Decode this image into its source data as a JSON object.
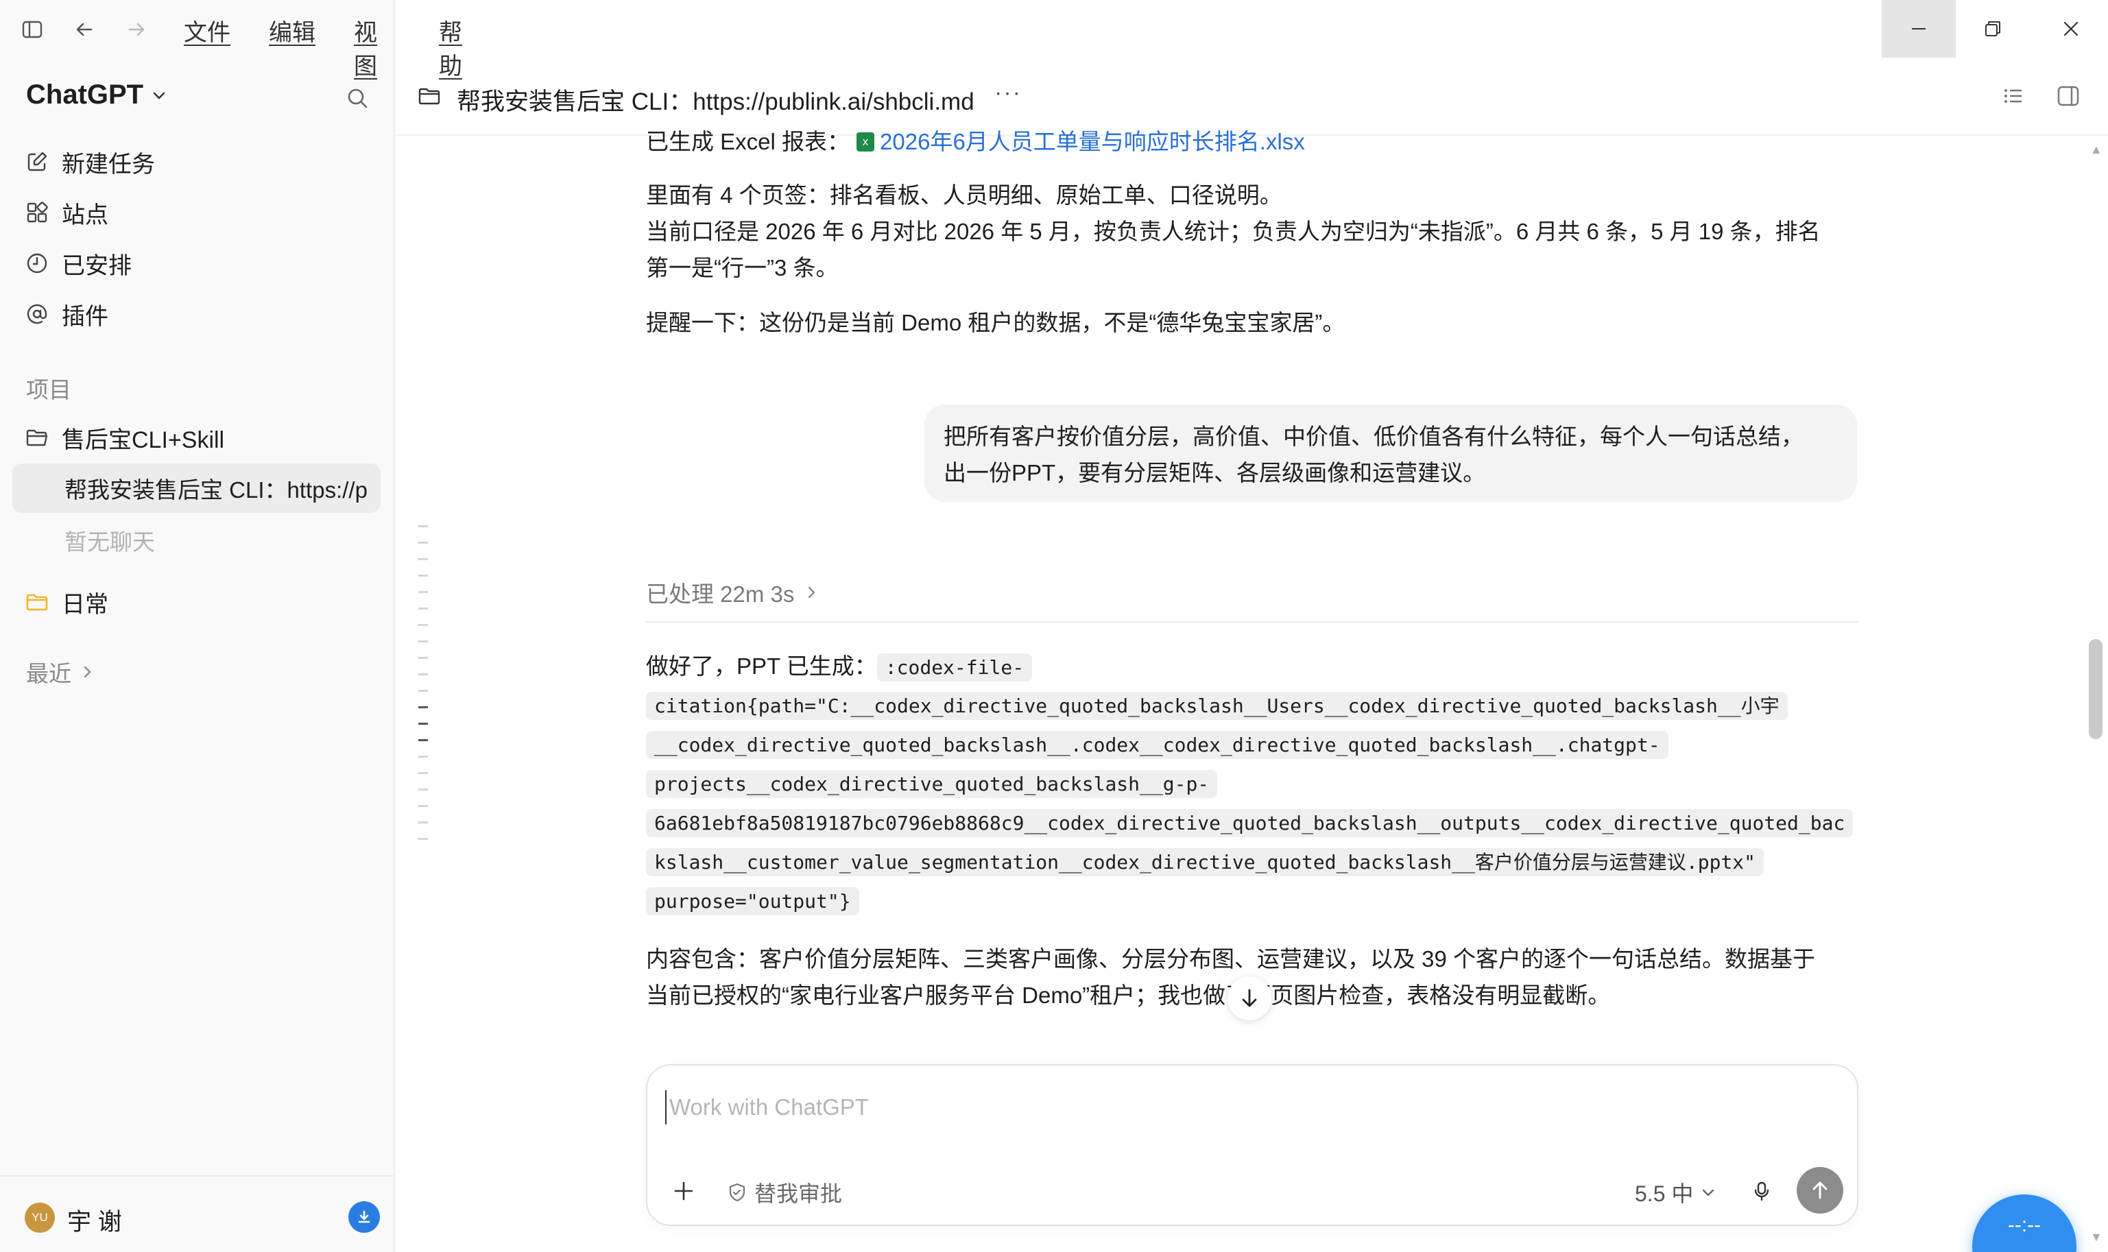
{
  "menubar": {
    "items": [
      "文件",
      "编辑",
      "视图",
      "帮助"
    ]
  },
  "sidebar": {
    "app_title": "ChatGPT",
    "nav": [
      {
        "label": "新建任务",
        "icon": "edit-icon"
      },
      {
        "label": "站点",
        "icon": "grid-icon"
      },
      {
        "label": "已安排",
        "icon": "clock-icon"
      },
      {
        "label": "插件",
        "icon": "at-icon"
      }
    ],
    "projects_label": "项目",
    "projects": [
      {
        "label": "售后宝CLI+Skill",
        "icon": "folder-open-icon"
      },
      {
        "label": "日常",
        "icon": "folder-icon",
        "color": "#f0b429"
      }
    ],
    "active_conversation": "帮我安装售后宝 CLI：https://p",
    "empty_chat": "暂无聊天",
    "recent_label": "最近",
    "user": {
      "initials": "YU",
      "name": "宇 谢"
    }
  },
  "header": {
    "title": "帮我安装售后宝 CLI：https://publink.ai/shbcli.md",
    "more": "···"
  },
  "messages": {
    "excel_prefix": "已生成 Excel 报表：",
    "excel_file": "2026年6月人员工单量与响应时长排名.xlsx",
    "excel_icon_letter": "x",
    "line1": "里面有 4 个页签：排名看板、人员明细、原始工单、口径说明。",
    "line2a": "当前口径是 2026 年 6 月对比 2026 年 5 月，按负责人统计；负责人为空归为“未指派”。6 月共 6 条，5 月 19 条，排名",
    "line2b": "第一是“行一”3 条。",
    "line3": "提醒一下：这份仍是当前 Demo 租户的数据，不是“德华兔宝宝家居”。",
    "user_msg_line1": "把所有客户按价值分层，高价值、中价值、低价值各有什么特征，每个人一句话总结，",
    "user_msg_line2": "出一份PPT，要有分层矩阵、各层级画像和运营建议。",
    "processed": "已处理 22m 3s",
    "done_prefix": "做好了，PPT 已生成：",
    "code": [
      ":codex-file-",
      "citation{path=\"C:__codex_directive_quoted_backslash__Users__codex_directive_quoted_backslash__小宇",
      "__codex_directive_quoted_backslash__.codex__codex_directive_quoted_backslash__.chatgpt-",
      "projects__codex_directive_quoted_backslash__g-p-",
      "6a681ebf8a50819187bc0796eb8868c9__codex_directive_quoted_backslash__outputs__codex_directive_quoted_bac",
      "kslash__customer_value_segmentation__codex_directive_quoted_backslash__客户价值分层与运营建议.pptx\"",
      "purpose=\"output\"}"
    ],
    "summary_a": "内容包含：客户价值分层矩阵、三类客户画像、分层分布图、运营建议，以及 39 个客户的逐个一句话总结。数据基于",
    "summary_b_left": "当前已授权的“家电行业客户服务平台 Demo”租户；我也做",
    "summary_b_right": "了逐页图片检查，表格没有明显截断。"
  },
  "composer": {
    "placeholder": "Work with ChatGPT",
    "approve_label": "替我审批",
    "model_label": "5.5 中"
  },
  "floater": {
    "text": "--:--"
  }
}
